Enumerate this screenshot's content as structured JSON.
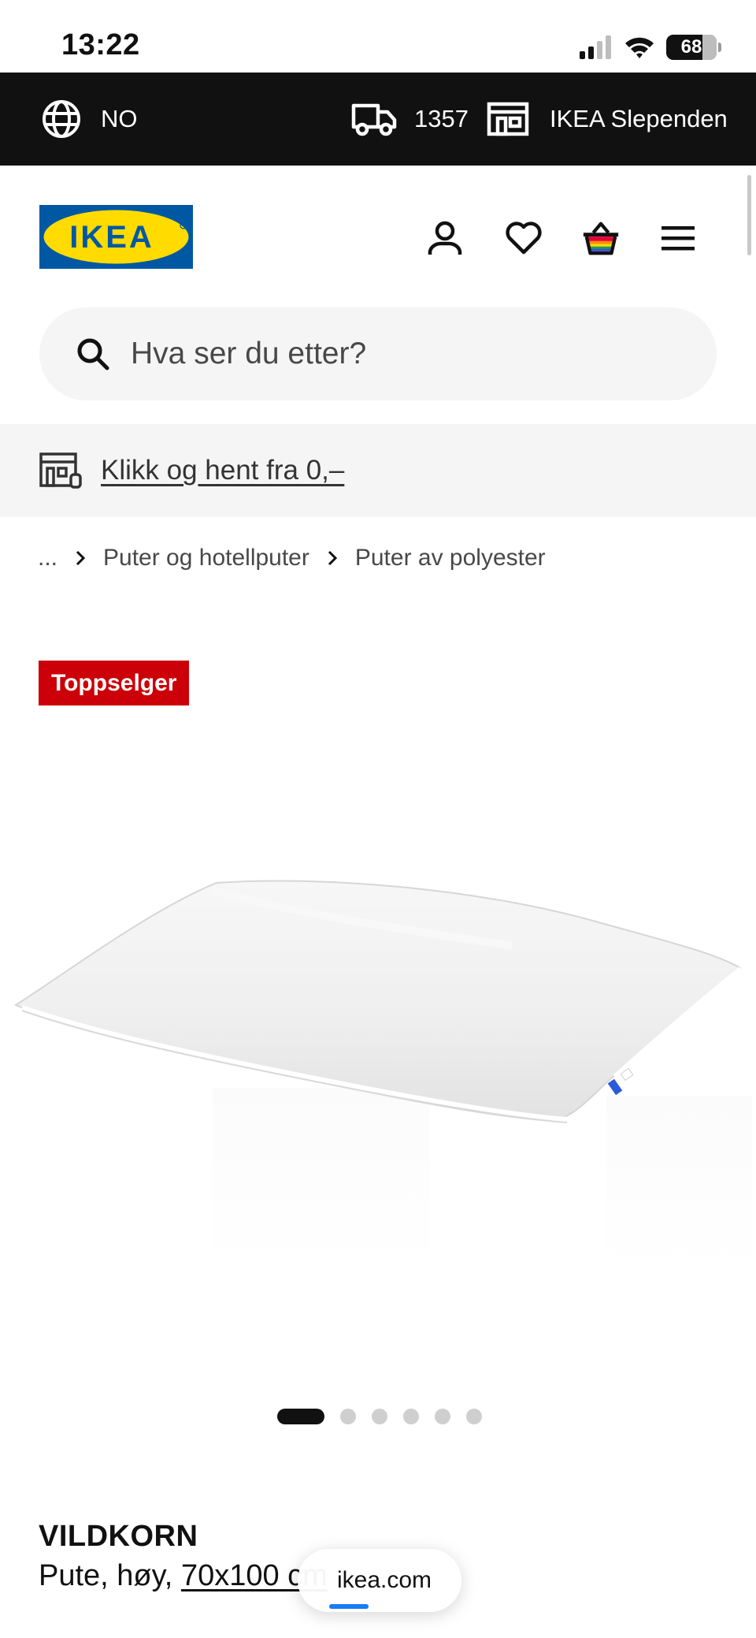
{
  "status_bar": {
    "time": "13:22",
    "battery": "68"
  },
  "top_bar": {
    "country": "NO",
    "delivery_postcode": "1357",
    "store": "IKEA Slependen"
  },
  "header": {
    "logo_text": "IKEA"
  },
  "search": {
    "placeholder": "Hva ser du etter?"
  },
  "promo": {
    "text": "Klikk og hent fra 0,–"
  },
  "breadcrumb": {
    "ellipsis": "...",
    "items": [
      "Puter og hotellputer",
      "Puter av polyester"
    ]
  },
  "badge": "Toppselger",
  "carousel": {
    "total": 6,
    "active": 1
  },
  "product": {
    "name": "VILDKORN",
    "description": "Pute, høy, ",
    "size": "70x100 cm"
  },
  "browser": {
    "url": "ikea.com"
  },
  "colors": {
    "brand_blue": "#0058a3",
    "brand_yellow": "#ffdb00",
    "badge_red": "#cc0008",
    "top_bar": "#111111"
  }
}
